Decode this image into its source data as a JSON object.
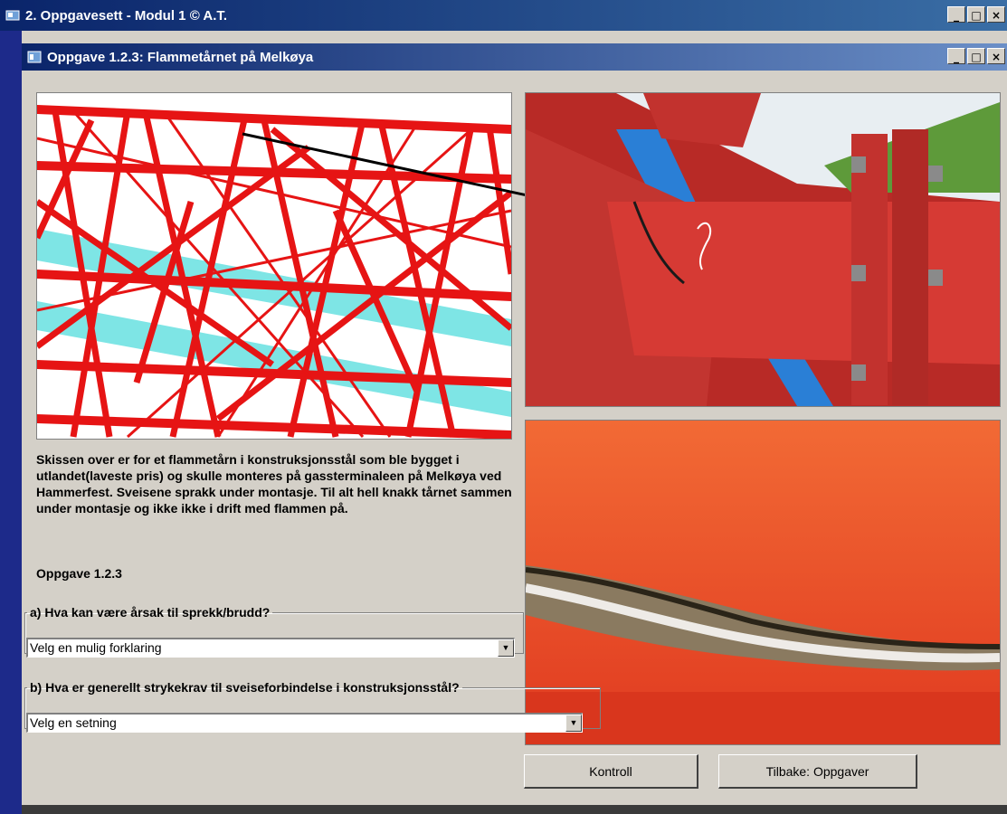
{
  "outer_window": {
    "title": "2. Oppgavesett -  Modul 1  © A.T."
  },
  "inner_window": {
    "title": "Oppgave 1.2.3: Flammetårnet på Melkøya"
  },
  "window_controls": {
    "minimize": "_",
    "maximize": "□",
    "close": "×"
  },
  "description": "Skissen over er for et flammetårn i konstruksjonsstål som ble bygget i utlandet(laveste pris) og skulle monteres på gassterminaleen på Melkøya ved Hammerfest. Sveisene sprakk under montasje. Til alt hell knakk tårnet sammen under montasje og ikke ikke i drift med flammen på.",
  "task_label": "Oppgave 1.2.3",
  "question_a": {
    "legend": "a) Hva kan være årsak til sprekk/brudd?",
    "selected": "Velg en mulig forklaring"
  },
  "question_b": {
    "legend": "b) Hva er generellt strykekrav til sveiseforbindelse i konstruksjonsstål?",
    "selected": "Velg en setning"
  },
  "buttons": {
    "check": "Kontroll",
    "back": "Tilbake: Oppgaver"
  },
  "icons": {
    "app": "app-icon",
    "dropdown": "dropdown-arrow-icon"
  }
}
